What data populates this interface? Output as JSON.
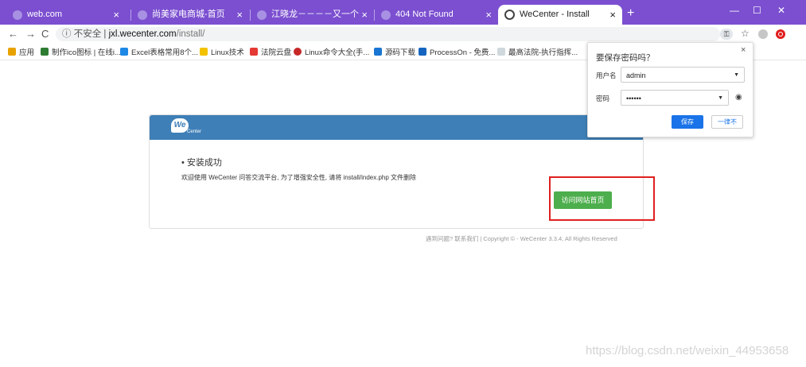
{
  "tabs": [
    {
      "title": "web.com"
    },
    {
      "title": "尚美家电商城-首页"
    },
    {
      "title": "江晓龙－－－－又一个WordPress站点"
    },
    {
      "title": "404 Not Found"
    },
    {
      "title": "WeCenter - Install"
    }
  ],
  "new_tab_label": "+",
  "window_controls": {
    "minimize": "—",
    "maximize": "☐",
    "close": "✕"
  },
  "nav": {
    "back": "←",
    "forward": "→",
    "reload": "C"
  },
  "address": {
    "info_icon": "ⓘ",
    "security": "不安全",
    "separator": "|",
    "host": "jxl.wecenter.com",
    "path": "/install/"
  },
  "bookmarks": [
    {
      "label": "应用",
      "color": "#e8a200"
    },
    {
      "label": "制作ico图标 | 在线i...",
      "color": "#2e7d32"
    },
    {
      "label": "Excel表格常用8个...",
      "color": "#1e88e5"
    },
    {
      "label": "Linux技术",
      "color": "#f2c200"
    },
    {
      "label": "法院云盘",
      "color": "#e53935"
    },
    {
      "label": "Linux命令大全(手...",
      "color": "#c62828"
    },
    {
      "label": "源码下载",
      "color": "#1976d2"
    },
    {
      "label": "ProcessOn - 免费...",
      "color": "#1565c0"
    },
    {
      "label": "最高法院-执行指挥...",
      "color": "#cfd8dc"
    }
  ],
  "card": {
    "logo_text": "We",
    "logo_sub": "Center",
    "success_text": "• 安装成功",
    "welcome_text": "欢迎使用 WeCenter 问答交流平台, 为了增强安全性, 请将 install/index.php 文件删除",
    "visit_button": "访问网站首页"
  },
  "footer": "遇到问题? 联系我们 | Copyright © - WeCenter 3.3.4, All Rights Reserved",
  "watermark": "https://blog.csdn.net/weixin_44953658",
  "popup": {
    "title": "要保存密码吗？",
    "close": "×",
    "username_label": "用户名",
    "username_value": "admin",
    "password_label": "密码",
    "password_value": "••••••",
    "save_button": "保存",
    "never_button": "一律不"
  },
  "icons": {
    "close": "×",
    "caret": "▼",
    "eye": "◉",
    "star": "☆",
    "key": "⚿"
  },
  "colors": {
    "tabstrip": "#7b4fd0",
    "card_header": "#3e7fb7",
    "visit_button": "#4cae4c",
    "save_button": "#1a73e8",
    "highlight_box": "#e02020"
  }
}
